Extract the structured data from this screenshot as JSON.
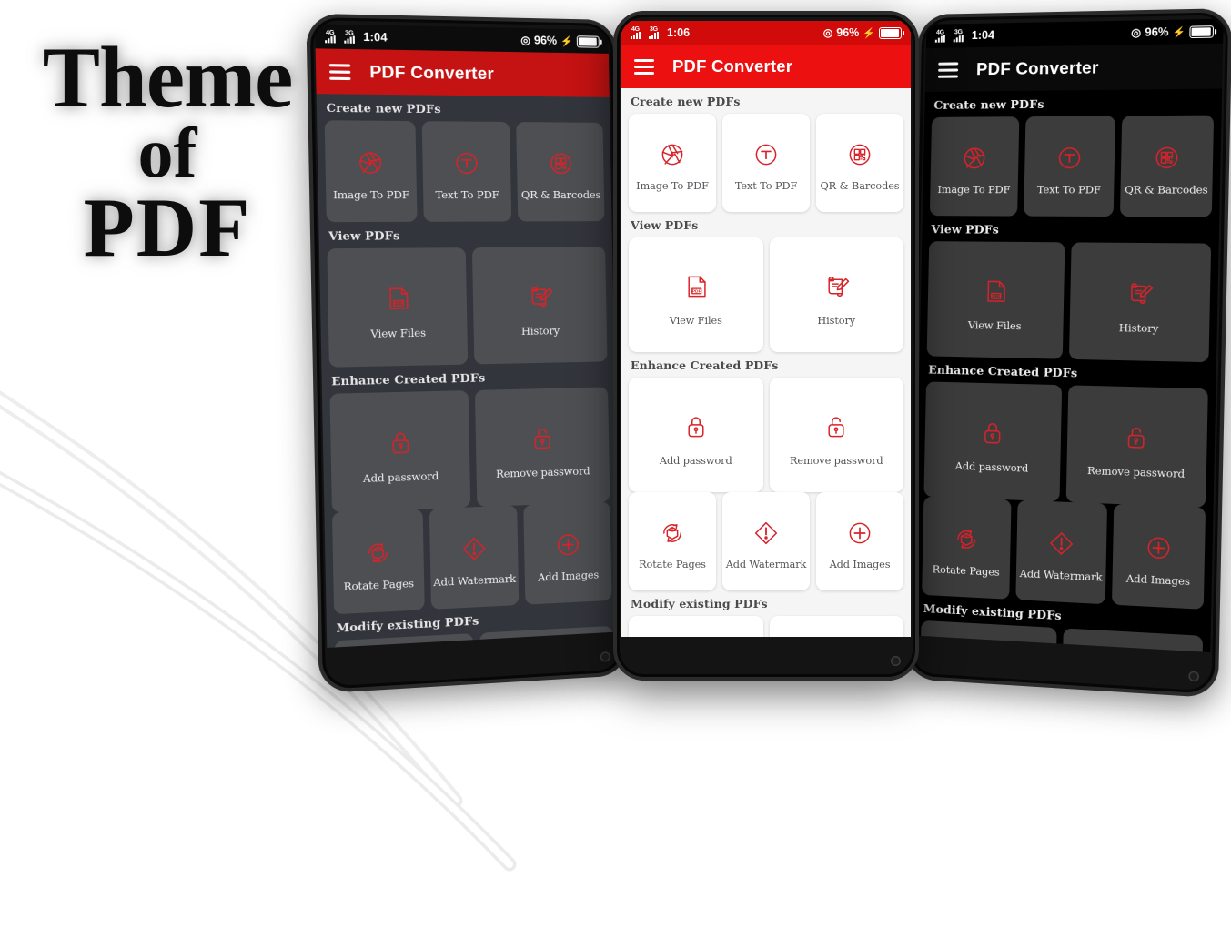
{
  "promo": {
    "line1": "Theme",
    "line2": "of",
    "line3": "PDF"
  },
  "app": {
    "title": "PDF Converter",
    "menu_icon": "hamburger-menu-icon"
  },
  "colors": {
    "brand_red": "#ec1010",
    "status_red_dark": "#d10a0a",
    "dark_bg": "#33353d",
    "dark_card": "#4d4f52",
    "amoled_bg": "#000000",
    "amoled_card": "#3c3c3c",
    "light_bg": "#f5f5f5",
    "light_card": "#ffffff",
    "icon_red": "#d8232a"
  },
  "phones": [
    {
      "id": "phone-left",
      "theme_name": "dark",
      "status": {
        "network_1": "4G",
        "network_2": "3G",
        "time": "1:04",
        "wifi": "wifi-icon",
        "battery_percent": "96%",
        "charging": "charging-bolt-icon"
      }
    },
    {
      "id": "phone-center",
      "theme_name": "light",
      "status": {
        "network_1": "4G",
        "network_2": "3G",
        "time": "1:06",
        "wifi": "wifi-icon",
        "battery_percent": "96%",
        "charging": "charging-bolt-icon"
      }
    },
    {
      "id": "phone-right",
      "theme_name": "amoled",
      "status": {
        "network_1": "4G",
        "network_2": "3G",
        "time": "1:04",
        "wifi": "wifi-icon",
        "battery_percent": "96%",
        "charging": "charging-bolt-icon"
      }
    }
  ],
  "sections": [
    {
      "title": "Create new PDFs",
      "items": [
        {
          "label": "Image To PDF",
          "icon": "camera-aperture-plus-icon"
        },
        {
          "label": "Text To PDF",
          "icon": "text-circle-icon"
        },
        {
          "label": "QR & Barcodes",
          "icon": "qr-code-circle-icon"
        }
      ]
    },
    {
      "title": "View PDFs",
      "items": [
        {
          "label": "View Files",
          "icon": "pdf-file-icon"
        },
        {
          "label": "History",
          "icon": "scroll-pencil-icon"
        }
      ]
    },
    {
      "title": "Enhance Created PDFs",
      "items": [
        {
          "label": "Add password",
          "icon": "lock-closed-icon"
        },
        {
          "label": "Remove password",
          "icon": "lock-open-icon"
        }
      ]
    },
    {
      "title": "",
      "items": [
        {
          "label": "Rotate Pages",
          "icon": "rotate-cube-icon"
        },
        {
          "label": "Add Watermark",
          "icon": "watermark-diamond-icon"
        },
        {
          "label": "Add Images",
          "icon": "plus-circle-icon"
        }
      ]
    },
    {
      "title": "Modify existing PDFs",
      "items": [
        {
          "label": "",
          "icon": "arrow-up-icon"
        },
        {
          "label": "",
          "icon": "merge-arrows-icon"
        }
      ]
    }
  ]
}
